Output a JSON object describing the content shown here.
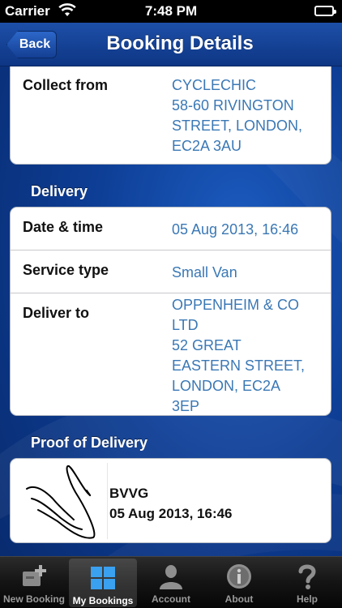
{
  "status_bar": {
    "carrier": "Carrier",
    "time": "7:48 PM"
  },
  "nav": {
    "back_label": "Back",
    "title": "Booking Details"
  },
  "collection": {
    "collect_from_label": "Collect from",
    "collect_from_lines": [
      "CYCLECHIC",
      "58-60 RIVINGTON",
      "STREET, LONDON,",
      "EC2A 3AU"
    ]
  },
  "delivery": {
    "header": "Delivery",
    "date_time_label": "Date & time",
    "date_time_value": "05 Aug 2013, 16:46",
    "service_type_label": "Service type",
    "service_type_value": "Small Van",
    "deliver_to_label": "Deliver to",
    "deliver_to_lines": [
      "OPPENHEIM & CO",
      "LTD",
      "52 GREAT",
      "EASTERN STREET,",
      "LONDON, EC2A",
      "3EP"
    ]
  },
  "proof_of_delivery": {
    "header": "Proof of Delivery",
    "signed_by": "BVVG",
    "signed_at": "05 Aug 2013, 16:46"
  },
  "tabs": [
    {
      "label": "New Booking",
      "icon": "new-booking-icon",
      "active": false
    },
    {
      "label": "My Bookings",
      "icon": "my-bookings-icon",
      "active": true
    },
    {
      "label": "Account",
      "icon": "account-icon",
      "active": false
    },
    {
      "label": "About",
      "icon": "info-icon",
      "active": false
    },
    {
      "label": "Help",
      "icon": "help-icon",
      "active": false
    }
  ],
  "colors": {
    "accent_value": "#3a78b5",
    "nav_blue": "#1d4fa8"
  }
}
